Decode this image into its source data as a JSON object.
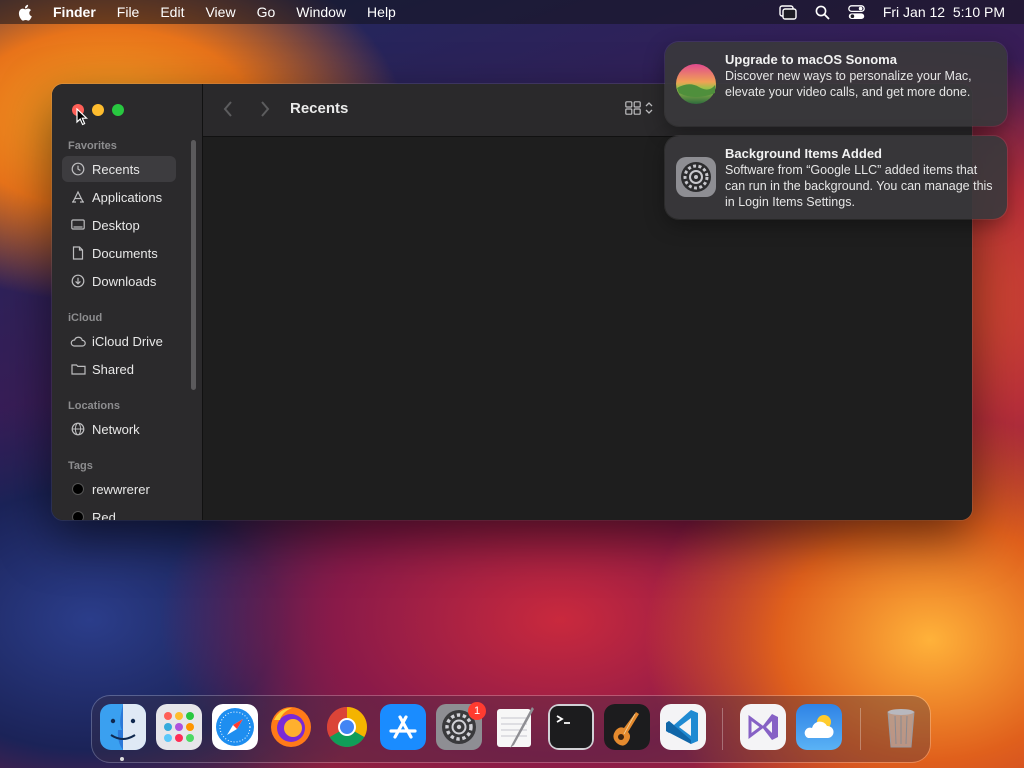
{
  "menubar": {
    "app_name": "Finder",
    "items": [
      "File",
      "Edit",
      "View",
      "Go",
      "Window",
      "Help"
    ],
    "datetime": "Fri Jan 12  5:10 PM"
  },
  "window": {
    "title": "Recents",
    "sidebar": {
      "favorites_header": "Favorites",
      "favorites": [
        "Recents",
        "Applications",
        "Desktop",
        "Documents",
        "Downloads"
      ],
      "icloud_header": "iCloud",
      "icloud": [
        "iCloud Drive",
        "Shared"
      ],
      "locations_header": "Locations",
      "locations": [
        "Network"
      ],
      "tags_header": "Tags",
      "tags": [
        "rewwrerer",
        "Red"
      ]
    }
  },
  "notifications": [
    {
      "title": "Upgrade to macOS Sonoma",
      "body": "Discover new ways to personalize your Mac, elevate your video calls, and get more done."
    },
    {
      "title": "Background Items Added",
      "body": "Software from “Google LLC” added items that can run in the background. You can manage this in Login Items Settings."
    }
  ],
  "dock": {
    "apps": [
      "Finder",
      "Launchpad",
      "Safari",
      "Firefox",
      "Google Chrome",
      "App Store",
      "System Settings",
      "TextEdit",
      "Terminal",
      "GarageBand",
      "Visual Studio Code",
      "Visual Studio",
      "Weather",
      "Trash"
    ],
    "settings_badge": "1"
  },
  "colors": {
    "close": "#ff5f57",
    "minimize": "#febc2e",
    "maximize": "#28c840",
    "badge": "#ff3b30"
  }
}
